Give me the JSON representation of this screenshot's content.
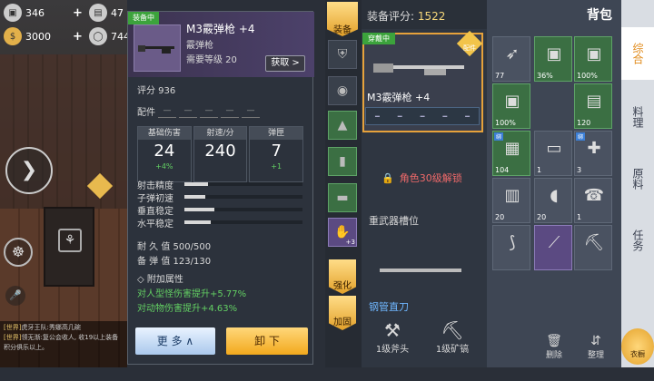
{
  "resources": [
    {
      "icon": "crate-icon",
      "value": "346",
      "plus": "+"
    },
    {
      "icon": "ticket-icon",
      "value": "47",
      "plus": ""
    },
    {
      "icon": "gold-coin-icon",
      "value": "3000",
      "plus": "+"
    },
    {
      "icon": "silver-coin-icon",
      "value": "744",
      "plus": ""
    }
  ],
  "chat": {
    "lines": [
      {
        "tag": "[世界]",
        "text": "虎牙王队:秀娜高几碗"
      },
      {
        "tag": "[世界]",
        "text": "领无渐:复公会收人, 收19以上装备"
      },
      {
        "tag": "",
        "text": "积分俱乐以上。"
      }
    ]
  },
  "detail": {
    "equip_tag": "装备中",
    "name": "M3霰弹枪",
    "plus": "+4",
    "type": "霰弹枪",
    "req_level": "需要等级 20",
    "obtain_label": "获取 >",
    "score_label": "评分 936",
    "parts_label": "配件",
    "stats": [
      {
        "header": "基础伤害",
        "value": "24",
        "bonus": "+4%"
      },
      {
        "header": "射速/分",
        "value": "240",
        "bonus": ""
      },
      {
        "header": "弹匣",
        "value": "7",
        "bonus": "+1"
      }
    ],
    "bars": [
      {
        "label": "射击精度",
        "fill": 0.2
      },
      {
        "label": "子弹初速",
        "fill": 0.18
      },
      {
        "label": "垂直稳定",
        "fill": 0.25
      },
      {
        "label": "水平稳定",
        "fill": 0.22
      }
    ],
    "durability": "耐 久 值  500/500",
    "ammo": "备 弹 值  123/130",
    "attr_title": "◇ 附加属性",
    "attrs": [
      "对人型怪伤害提升+5.77%",
      "对动物伤害提升+4.63%"
    ],
    "more_label": "更 多 ∧",
    "unequip_label": "卸 下"
  },
  "slots": {
    "title": "装备",
    "strengthen": "强化",
    "reinforce": "加固",
    "glove_count": "+3"
  },
  "center": {
    "rating_label": "装备评分: ",
    "rating_value": "1522",
    "wear_tag": "穿戴中",
    "weapon_name": "M3霰弹枪  +4",
    "rank_label": "配件",
    "lock_text": "角色30级解锁",
    "heavy_slot": "重武器槽位",
    "melee_name": "钢管直刀",
    "tool1": "1级斧头",
    "tool2": "1级矿镐"
  },
  "bag": {
    "title": "背包",
    "close": "✕",
    "delete_label": "删除",
    "sort_label": "整理",
    "items": [
      {
        "q": "77",
        "icon": "arrows-icon",
        "kind": ""
      },
      {
        "q": "36%",
        "icon": "crate-icon",
        "kind": "g"
      },
      {
        "q": "100%",
        "icon": "crate-icon",
        "kind": "g"
      },
      {
        "q": "100%",
        "icon": "crate-icon",
        "kind": "g"
      },
      {
        "q": "120",
        "icon": "box-icon",
        "kind": "g"
      },
      {
        "q": "104",
        "icon": "cooler-icon",
        "kind": "g",
        "bind": true
      },
      {
        "q": "1",
        "icon": "paper-icon",
        "kind": ""
      },
      {
        "q": "3",
        "icon": "medkit-icon",
        "kind": "",
        "bind": true
      },
      {
        "q": "20",
        "icon": "bandage-icon",
        "kind": ""
      },
      {
        "q": "20",
        "icon": "pills-icon",
        "kind": ""
      },
      {
        "q": "1",
        "icon": "phone-icon",
        "kind": ""
      },
      {
        "q": "",
        "icon": "bow-icon",
        "kind": ""
      },
      {
        "q": "",
        "icon": "rifle-icon",
        "kind": "p"
      },
      {
        "q": "",
        "icon": "pickaxe-icon",
        "kind": ""
      }
    ]
  },
  "categories": [
    "综合",
    "料理",
    "原料",
    "任务"
  ],
  "wardrobe": "衣橱"
}
